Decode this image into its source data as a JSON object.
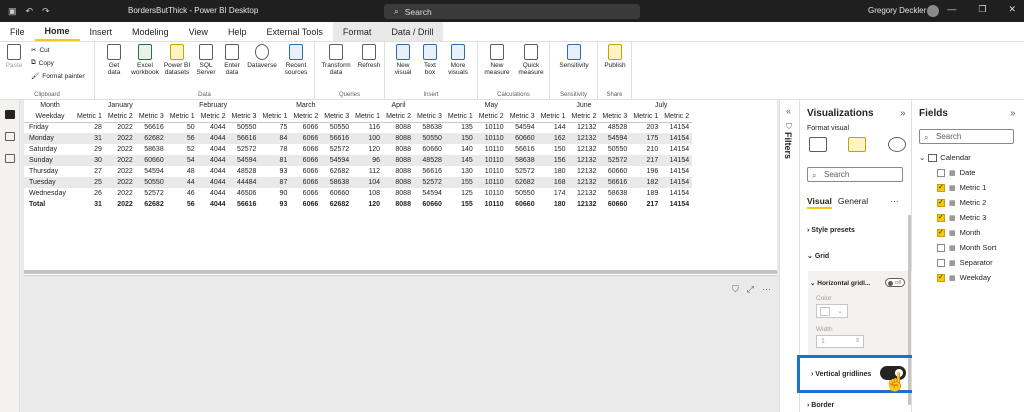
{
  "titlebar": {
    "title": "BordersButThick - Power BI Desktop",
    "search_placeholder": "Search",
    "user": "Gregory Deckler"
  },
  "menu": {
    "tabs": [
      "File",
      "Home",
      "Insert",
      "Modeling",
      "View",
      "Help",
      "External Tools",
      "Format",
      "Data / Drill"
    ]
  },
  "ribbon": {
    "clipboard": {
      "paste": "Paste",
      "cut": "Cut",
      "copy": "Copy",
      "format_painter": "Format painter",
      "label": "Clipboard"
    },
    "data": {
      "get_data": "Get data",
      "excel": "Excel workbook",
      "pbi_datasets": "Power BI datasets",
      "sql": "SQL Server",
      "enter_data": "Enter data",
      "dataverse": "Dataverse",
      "recent": "Recent sources",
      "label": "Data"
    },
    "queries": {
      "transform": "Transform data",
      "refresh": "Refresh",
      "label": "Queries"
    },
    "insert": {
      "new_visual": "New visual",
      "text_box": "Text box",
      "more_visuals": "More visuals",
      "label": "Insert"
    },
    "calculations": {
      "new_measure": "New measure",
      "quick_measure": "Quick measure",
      "label": "Calculations"
    },
    "sensitivity": {
      "sensitivity": "Sensitivity",
      "label": "Sensitivity"
    },
    "share": {
      "publish": "Publish",
      "label": "Share"
    }
  },
  "matrix": {
    "corner_top": "Month",
    "corner_bottom": "Weekday",
    "months": [
      "January",
      "February",
      "March",
      "April",
      "May",
      "June",
      "July"
    ],
    "metrics": [
      "Metric 1",
      "Metric 2",
      "Metric 3"
    ],
    "rows": [
      {
        "name": "Friday",
        "values": [
          "28",
          "2022",
          "56616",
          "50",
          "4044",
          "50550",
          "75",
          "6066",
          "50550",
          "116",
          "8088",
          "58638",
          "135",
          "10110",
          "54594",
          "144",
          "12132",
          "48528",
          "203",
          "14154"
        ]
      },
      {
        "name": "Monday",
        "values": [
          "31",
          "2022",
          "62682",
          "56",
          "4044",
          "56616",
          "84",
          "6066",
          "56616",
          "100",
          "8088",
          "50550",
          "150",
          "10110",
          "60660",
          "162",
          "12132",
          "54594",
          "175",
          "14154"
        ]
      },
      {
        "name": "Saturday",
        "values": [
          "29",
          "2022",
          "58638",
          "52",
          "4044",
          "52572",
          "78",
          "6066",
          "52572",
          "120",
          "8088",
          "60660",
          "140",
          "10110",
          "56616",
          "150",
          "12132",
          "50550",
          "210",
          "14154"
        ]
      },
      {
        "name": "Sunday",
        "values": [
          "30",
          "2022",
          "60660",
          "54",
          "4044",
          "54594",
          "81",
          "6066",
          "54594",
          "96",
          "8088",
          "48528",
          "145",
          "10110",
          "58638",
          "156",
          "12132",
          "52572",
          "217",
          "14154"
        ]
      },
      {
        "name": "Thursday",
        "values": [
          "27",
          "2022",
          "54594",
          "48",
          "4044",
          "48528",
          "93",
          "6066",
          "62682",
          "112",
          "8088",
          "56616",
          "130",
          "10110",
          "52572",
          "180",
          "12132",
          "60660",
          "196",
          "14154"
        ]
      },
      {
        "name": "Tuesday",
        "values": [
          "25",
          "2022",
          "50550",
          "44",
          "4044",
          "44484",
          "87",
          "6066",
          "58638",
          "104",
          "8088",
          "52572",
          "155",
          "10110",
          "62682",
          "168",
          "12132",
          "56616",
          "182",
          "14154"
        ]
      },
      {
        "name": "Wednesday",
        "values": [
          "26",
          "2022",
          "52572",
          "46",
          "4044",
          "46506",
          "90",
          "6066",
          "60660",
          "108",
          "8088",
          "54594",
          "125",
          "10110",
          "50550",
          "174",
          "12132",
          "58638",
          "189",
          "14154"
        ]
      }
    ],
    "total": {
      "name": "Total",
      "values": [
        "31",
        "2022",
        "62682",
        "56",
        "4044",
        "56616",
        "93",
        "6066",
        "62682",
        "120",
        "8088",
        "60660",
        "155",
        "10110",
        "60660",
        "180",
        "12132",
        "60660",
        "217",
        "14154"
      ]
    }
  },
  "filters": {
    "label": "Filters"
  },
  "viz_pane": {
    "title": "Visualizations",
    "format_visual": "Format visual",
    "search_placeholder": "Search",
    "tab_visual": "Visual",
    "tab_general": "General",
    "more": "···",
    "style_presets": "Style presets",
    "grid": "Grid",
    "horizontal_gridlines": "Horizontal gridl...",
    "toggle_off": "Off",
    "color_label": "Color",
    "width_label": "Width",
    "width_value": "1",
    "vertical_gridlines": "Vertical gridlines",
    "border": "Border",
    "highlight_color": "#1a73c9"
  },
  "fields_pane": {
    "title": "Fields",
    "search_placeholder": "Search",
    "table": "Calendar",
    "fields": [
      {
        "name": "Date",
        "checked": false
      },
      {
        "name": "Metric 1",
        "checked": true
      },
      {
        "name": "Metric 2",
        "checked": true
      },
      {
        "name": "Metric 3",
        "checked": true
      },
      {
        "name": "Month",
        "checked": true
      },
      {
        "name": "Month Sort",
        "checked": false
      },
      {
        "name": "Separator",
        "checked": false
      },
      {
        "name": "Weekday",
        "checked": true
      }
    ]
  }
}
